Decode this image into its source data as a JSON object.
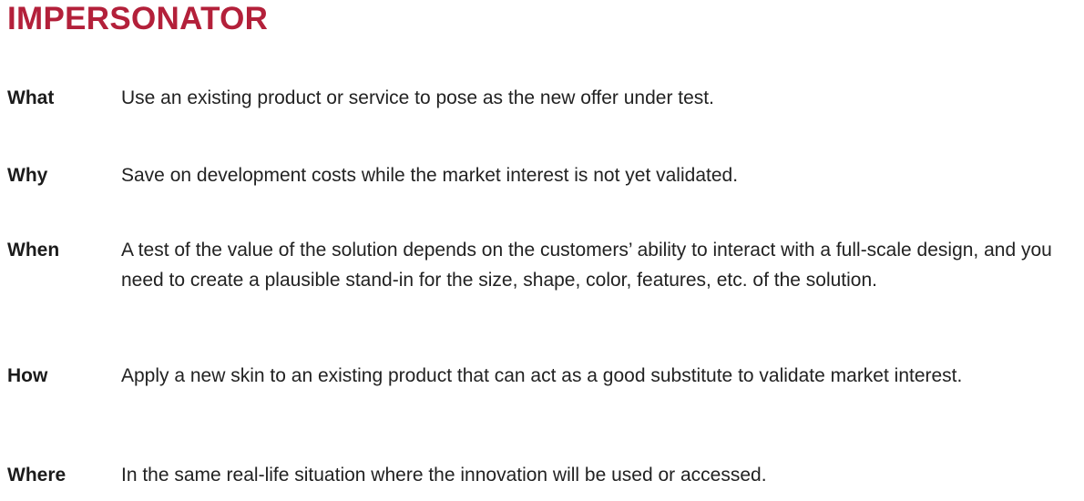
{
  "title": "IMPERSONATOR",
  "rows": [
    {
      "term": "What",
      "description": "Use an existing product or service to pose as the new offer under test."
    },
    {
      "term": "Why",
      "description": "Save on development costs while the market interest is not yet validated."
    },
    {
      "term": "When",
      "description": "A test of the value of the solution depends on the customers’ ability to interact with a full-scale design, and you need to create a plausible stand-in for the size, shape, color, features, etc. of the solution."
    },
    {
      "term": "How",
      "description": "Apply a new skin to an existing product that can act as a good substitute to validate market interest."
    },
    {
      "term": "Where",
      "description": "In the same real-life situation where the innovation will be used or accessed."
    }
  ],
  "colors": {
    "title": "#b3203a",
    "text": "#222222"
  }
}
